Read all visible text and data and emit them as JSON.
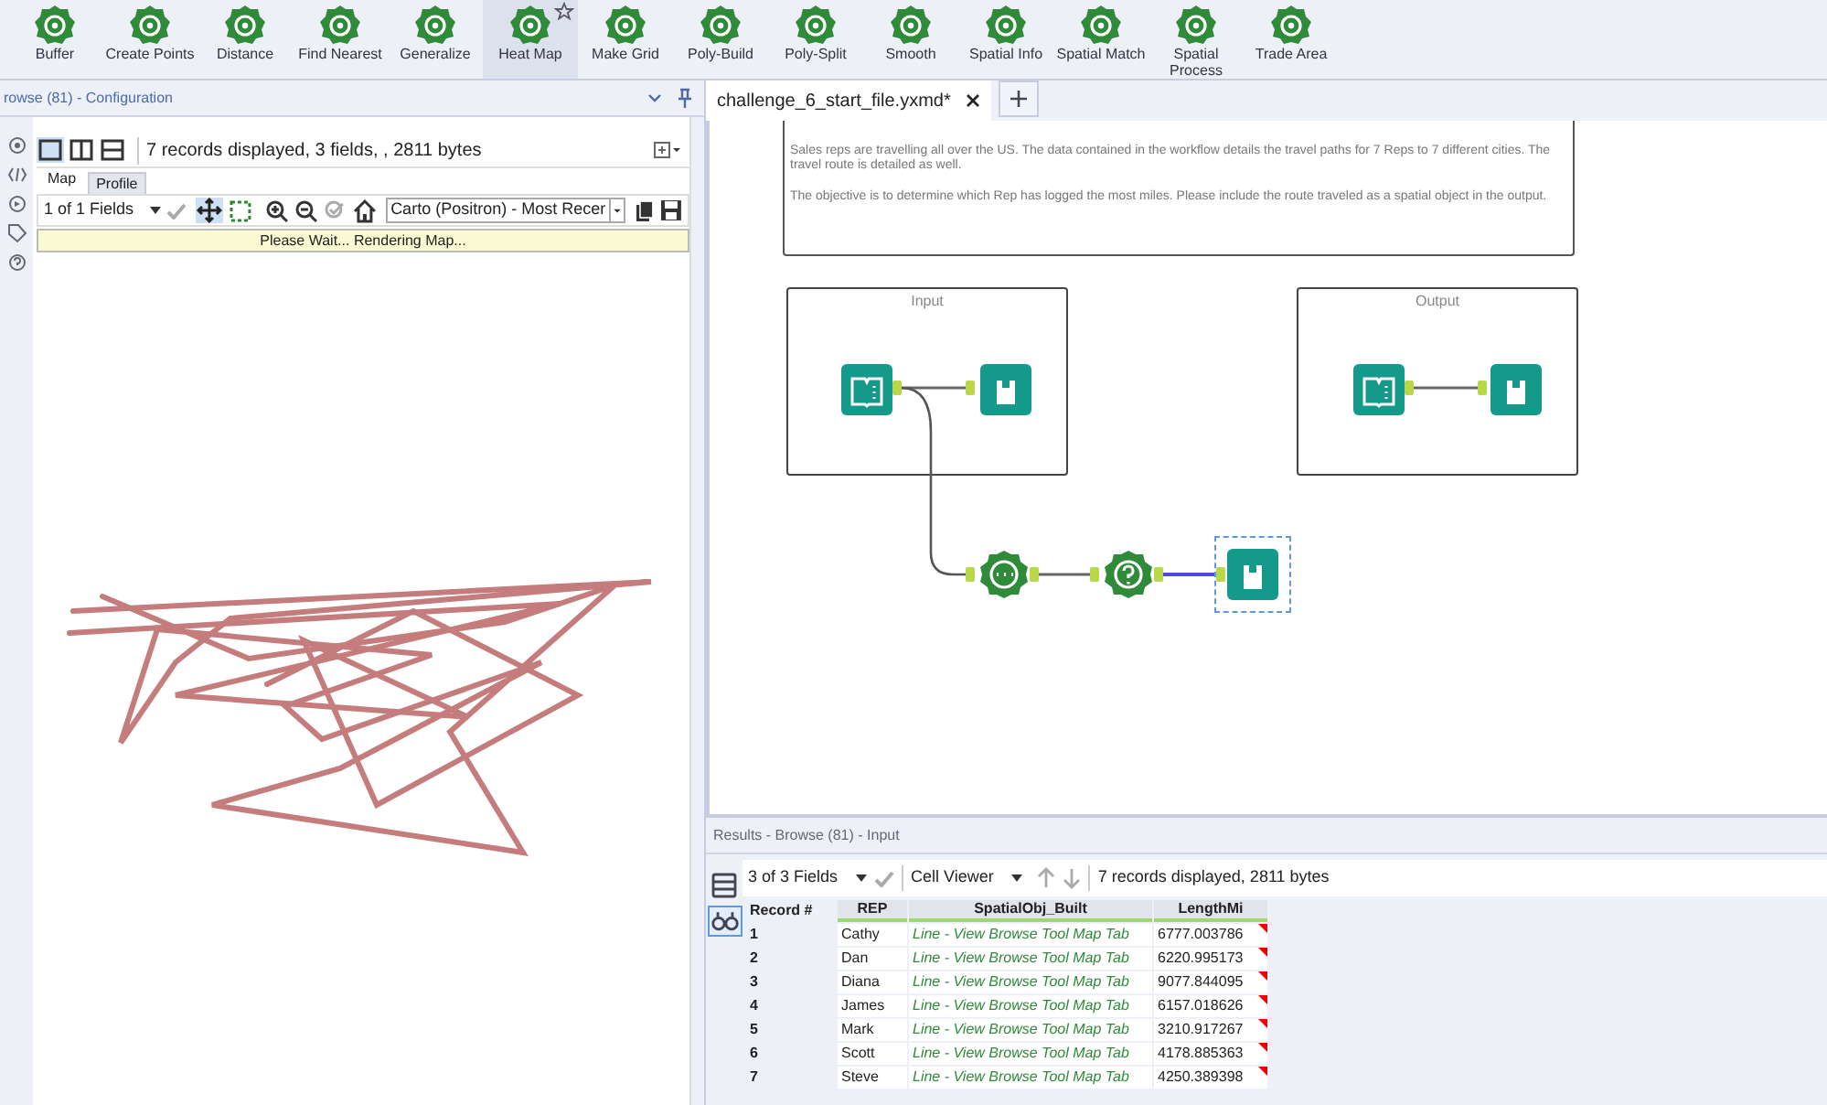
{
  "toolbar": {
    "tools": [
      {
        "label": "Buffer",
        "selected": false
      },
      {
        "label": "Create Points",
        "selected": false
      },
      {
        "label": "Distance",
        "selected": false
      },
      {
        "label": "Find Nearest",
        "selected": false
      },
      {
        "label": "Generalize",
        "selected": false
      },
      {
        "label": "Heat Map",
        "selected": true
      },
      {
        "label": "Make Grid",
        "selected": false
      },
      {
        "label": "Poly-Build",
        "selected": false
      },
      {
        "label": "Poly-Split",
        "selected": false
      },
      {
        "label": "Smooth",
        "selected": false
      },
      {
        "label": "Spatial Info",
        "selected": false
      },
      {
        "label": "Spatial Match",
        "selected": false
      },
      {
        "label": "Spatial Process",
        "selected": false
      },
      {
        "label": "Trade Area",
        "selected": false
      }
    ]
  },
  "config_panel": {
    "title": "rowse (81) - Configuration",
    "status": "7 records displayed, 3 fields, , 2811 bytes",
    "tabs": [
      {
        "label": "Map",
        "selected": true
      },
      {
        "label": "Profile",
        "selected": false
      }
    ],
    "fields_dropdown": "1 of 1 Fields",
    "basemap": "Carto (Positron) - Most Recer",
    "message": "Please Wait... Rendering Map..."
  },
  "document_tabs": [
    {
      "label": "challenge_6_start_file.yxmd*",
      "selected": true
    }
  ],
  "canvas": {
    "comment": [
      "Sales reps are travelling all over the US.  The data contained in the workflow details the travel paths for 7 Reps to 7 different cities. The travel route is detailed as well.",
      "The objective is to determine which Rep has logged the most miles. Please include the route traveled as a spatial object in the output."
    ],
    "containers": [
      {
        "title": "Input"
      },
      {
        "title": "Output"
      }
    ]
  },
  "results": {
    "title": "Results - Browse (81) - Input",
    "fields_dropdown": "3 of 3 Fields",
    "viewer": "Cell Viewer",
    "status": "7 records displayed, 2811 bytes",
    "columns": [
      "Record #",
      "REP",
      "SpatialObj_Built",
      "LengthMi"
    ],
    "rows": [
      [
        "1",
        "Cathy",
        "Line - View Browse Tool Map Tab",
        "6777.003786"
      ],
      [
        "2",
        "Dan",
        "Line - View Browse Tool Map Tab",
        "6220.995173"
      ],
      [
        "3",
        "Diana",
        "Line - View Browse Tool Map Tab",
        "9077.844095"
      ],
      [
        "4",
        "James",
        "Line - View Browse Tool Map Tab",
        "6157.018626"
      ],
      [
        "5",
        "Mark",
        "Line - View Browse Tool Map Tab",
        "3210.917267"
      ],
      [
        "6",
        "Scott",
        "Line - View Browse Tool Map Tab",
        "4178.885363"
      ],
      [
        "7",
        "Steve",
        "Line - View Browse Tool Map Tab",
        "4250.389398"
      ]
    ]
  }
}
